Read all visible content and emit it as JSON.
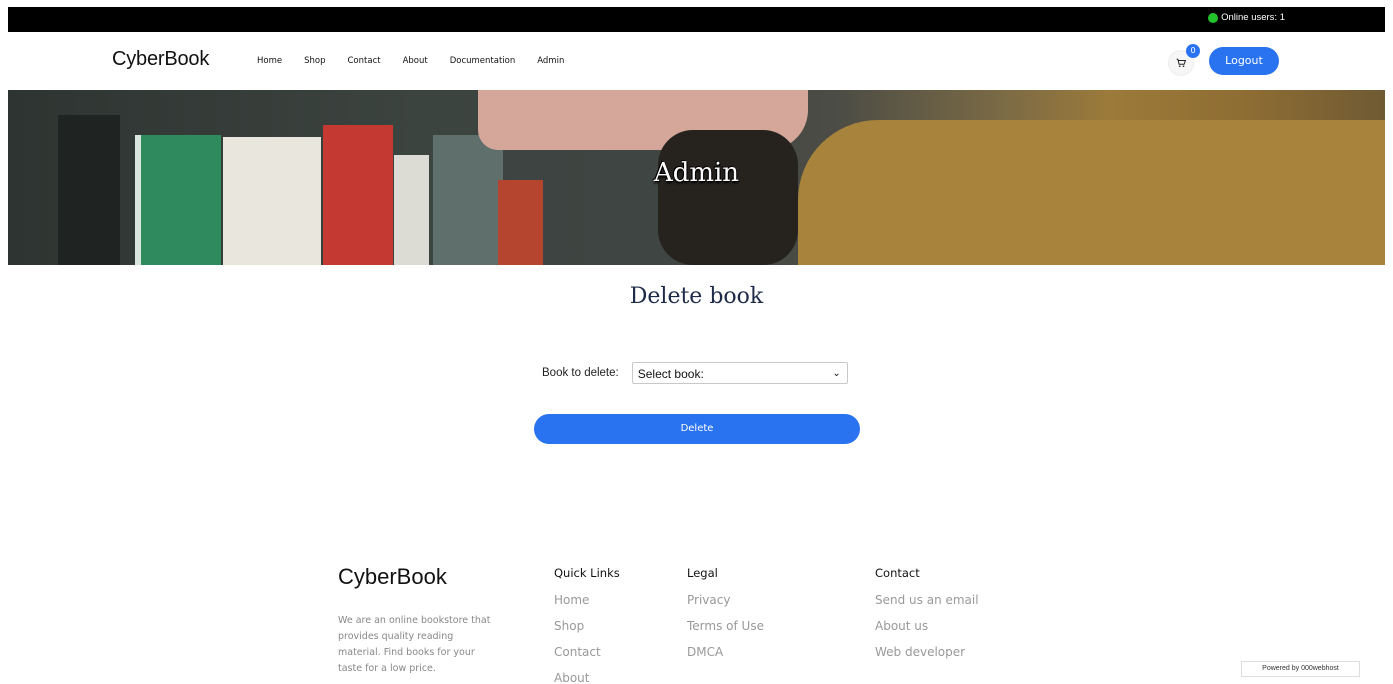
{
  "topbar": {
    "online_label": "Online users: 1"
  },
  "nav": {
    "brand": "CyberBook",
    "links": [
      "Home",
      "Shop",
      "Contact",
      "About",
      "Documentation",
      "Admin"
    ],
    "cart_count": "0",
    "logout_label": "Logout"
  },
  "hero": {
    "title": "Admin"
  },
  "main": {
    "heading": "Delete book",
    "field_label": "Book to delete:",
    "select_value": "Select book:",
    "delete_label": "Delete"
  },
  "footer": {
    "brand": "CyberBook",
    "description": "We are an online bookstore that provides quality reading material. Find books for your taste for a low price.",
    "quick_links": {
      "heading": "Quick Links",
      "items": [
        "Home",
        "Shop",
        "Contact",
        "About"
      ]
    },
    "legal": {
      "heading": "Legal",
      "items": [
        "Privacy",
        "Terms of Use",
        "DMCA"
      ]
    },
    "contact": {
      "heading": "Contact",
      "items": [
        "Send us an email",
        "About us",
        "Web developer"
      ]
    }
  },
  "powered_by": "Powered by  000webhost",
  "colors": {
    "accent": "#2a73f0",
    "online": "#22c22b",
    "heading": "#1e2b48"
  }
}
